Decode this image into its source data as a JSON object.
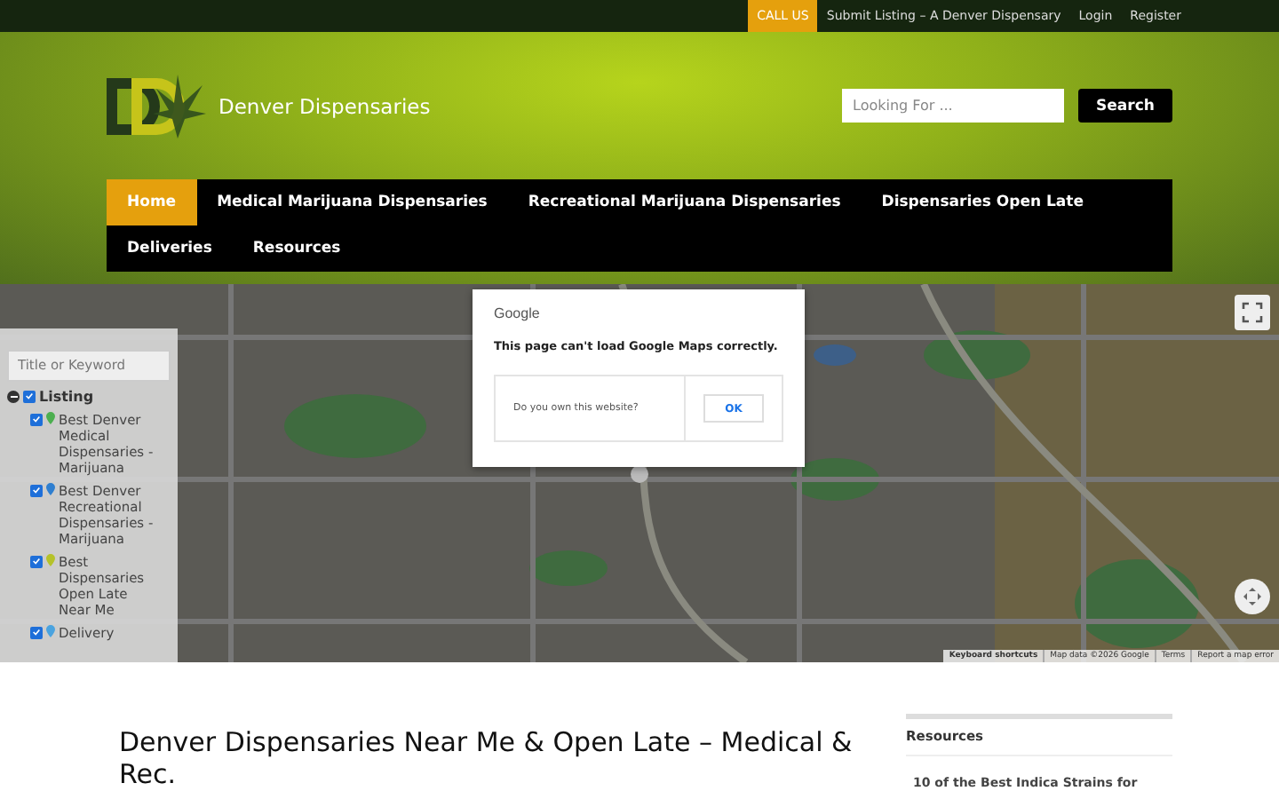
{
  "top_bar": {
    "links": [
      {
        "label": "CALL US",
        "selected": true
      },
      {
        "label": "Submit Listing – A Denver Dispensary",
        "selected": false
      },
      {
        "label": "Login",
        "selected": false
      },
      {
        "label": "Register",
        "selected": false
      }
    ]
  },
  "header": {
    "site_name": "Denver Dispensaries",
    "search": {
      "placeholder": "Looking For ...",
      "button": "Search"
    }
  },
  "nav": [
    {
      "label": "Home",
      "selected": true
    },
    {
      "label": "Medical Marijuana Dispensaries",
      "selected": false
    },
    {
      "label": "Recreational Marijuana Dispensaries",
      "selected": false
    },
    {
      "label": "Dispensaries Open Late",
      "selected": false
    },
    {
      "label": "Deliveries",
      "selected": false
    },
    {
      "label": "Resources",
      "selected": false
    }
  ],
  "map": {
    "kind": "picture",
    "filter": {
      "placeholder": "Title or Keyword",
      "group": {
        "label": "Listing",
        "checked": true,
        "expanded": true,
        "children": [
          {
            "label": "Best Denver Medical Dispensaries - Marijuana",
            "checked": true,
            "color": "#4caf50"
          },
          {
            "label": "Best Denver Recreational Dispensaries - Marijuana",
            "checked": true,
            "color": "#2f7fd0"
          },
          {
            "label": "Best Dispensaries Open Late Near Me",
            "checked": true,
            "color": "#b5c22a"
          },
          {
            "label": "Delivery",
            "checked": true,
            "color": "#4aa3df"
          }
        ]
      }
    },
    "dialog": {
      "brand": "Google",
      "message": "This page can't load Google Maps correctly.",
      "question": "Do you own this website?",
      "button": "OK"
    },
    "footer_links": [
      "Keyboard shortcuts",
      "Map data ©2026 Google",
      "Terms",
      "Report a map error"
    ]
  },
  "main": {
    "title": "Denver Dispensaries Near Me & Open Late – Medical & Rec."
  },
  "sidebar": {
    "heading": "Resources",
    "items": [
      "10 of the Best Indica Strains for"
    ]
  }
}
